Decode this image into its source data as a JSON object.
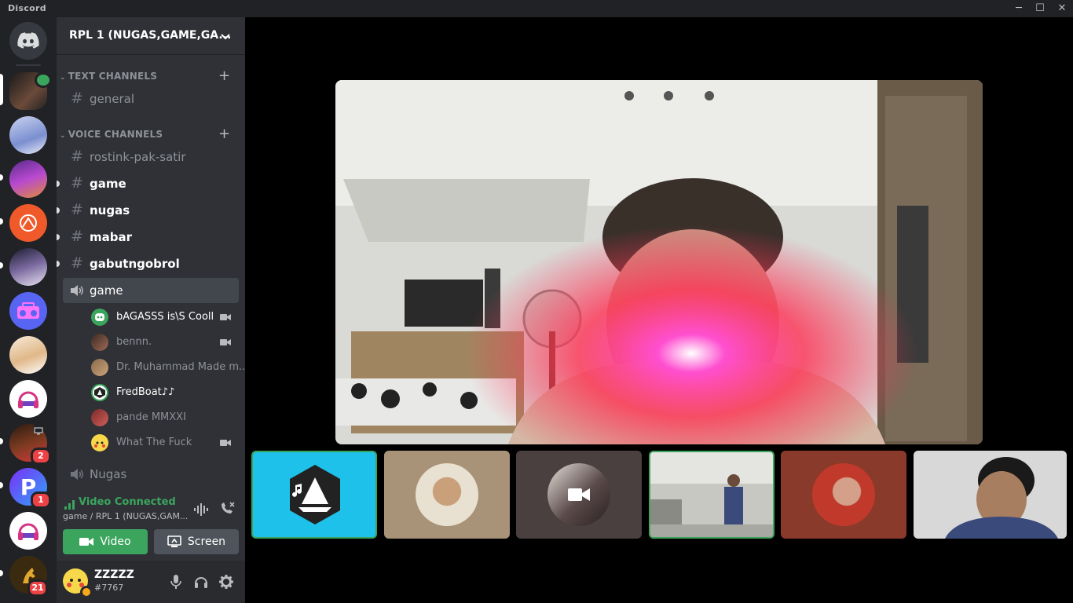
{
  "app": {
    "name": "Discord"
  },
  "window_controls": {
    "minimize": "─",
    "maximize": "☐",
    "close": "✕"
  },
  "server": {
    "name": "RPL 1 (NUGAS,GAME,GA..."
  },
  "guild_badges": {
    "b1": "2",
    "b2": "1",
    "b3": "21"
  },
  "categories": {
    "text": "TEXT CHANNELS",
    "voice": "VOICE CHANNELS"
  },
  "channels": {
    "general": "general",
    "rostink": "rostink-pak-satir",
    "game_text": "game",
    "nugas_text": "nugas",
    "mabar": "mabar",
    "gabut": "gabutngobrol",
    "game_voice": "game",
    "nugas_voice": "Nugas"
  },
  "voice_users": {
    "u1": "bAGASSS is\\S Cooll",
    "u2": "bennn.",
    "u3": "Dr. Muhammad Made m...",
    "u4": "FredBoat♪♪",
    "u5": "pande MMXXI",
    "u6": "What The Fuck"
  },
  "voice_status": {
    "title": "Video Connected",
    "subtitle": "game / RPL 1 (NUGAS,GAM..."
  },
  "buttons": {
    "video": "Video",
    "screen": "Screen"
  },
  "user": {
    "name": "ZZZZZ",
    "tag": "#7767"
  },
  "colors": {
    "blurple": "#5865f2",
    "green": "#3ba55d",
    "panel": "#2f3136",
    "dark": "#202225",
    "speaking": "#3ba55d",
    "fredboat": "#1ec1e9"
  }
}
